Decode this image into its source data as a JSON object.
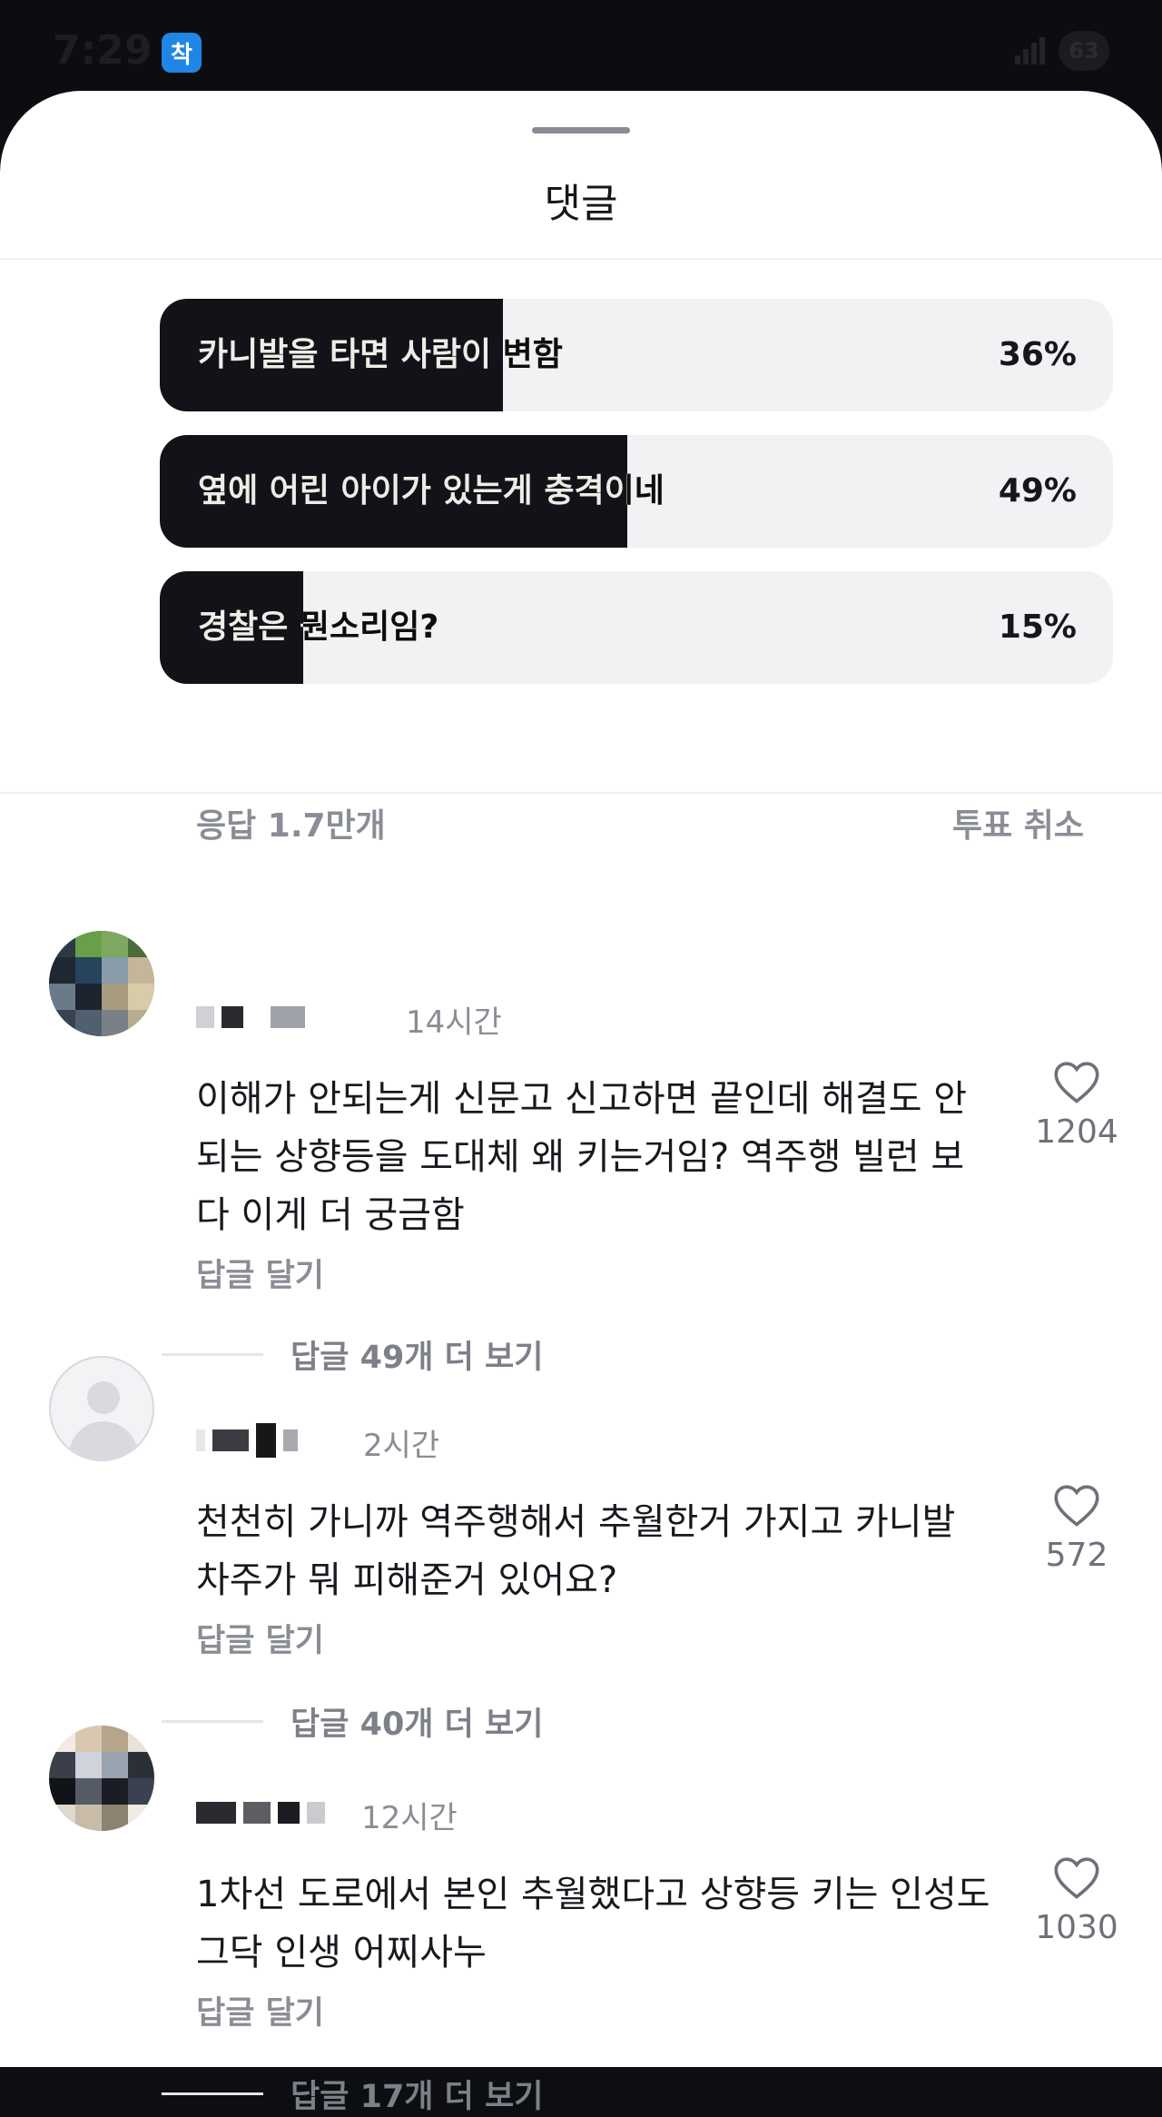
{
  "status_bar": {
    "time": "7:29",
    "app_badge": "착",
    "battery": "63"
  },
  "sheet": {
    "title": "댓글"
  },
  "poll": {
    "options": [
      {
        "label": "카니발을 타면 사람이 변함",
        "percent_text": "36%",
        "percent": 36
      },
      {
        "label": "옆에 어린 아이가 있는게 충격이네",
        "percent_text": "49%",
        "percent": 49
      },
      {
        "label": "경찰은 뭔소리임?",
        "percent_text": "15%",
        "percent": 15
      }
    ],
    "responses": "응답 1.7만개",
    "cancel_vote": "투표 취소"
  },
  "comments": [
    {
      "time": "14시간",
      "text": "이해가 안되는게 신문고 신고하면 끝인데 해결도 안되는 상향등을 도대체 왜 키는거임? 역주행 빌런 보다 이게 더 궁금함",
      "reply_label": "답글 달기",
      "view_replies": "답글 49개 더 보기",
      "likes": "1204"
    },
    {
      "time": "2시간",
      "text": "천천히 가니까 역주행해서 추월한거 가지고 카니발 차주가 뭐 피해준거 있어요?",
      "reply_label": "답글 달기",
      "view_replies": "답글 40개 더 보기",
      "likes": "572"
    },
    {
      "time": "12시간",
      "text": "1차선 도로에서 본인 추월했다고 상향등 키는 인성도 그닥 인생 어찌사누",
      "reply_label": "답글 달기",
      "view_replies": "답글 17개 더 보기",
      "likes": "1030"
    }
  ],
  "colors": {
    "accent_dark": "#121318",
    "muted_text": "#8a8d95",
    "poll_track": "#f1f2f4"
  },
  "icons": {
    "like": "heart-outline-icon",
    "default_avatar": "person-placeholder-icon"
  }
}
